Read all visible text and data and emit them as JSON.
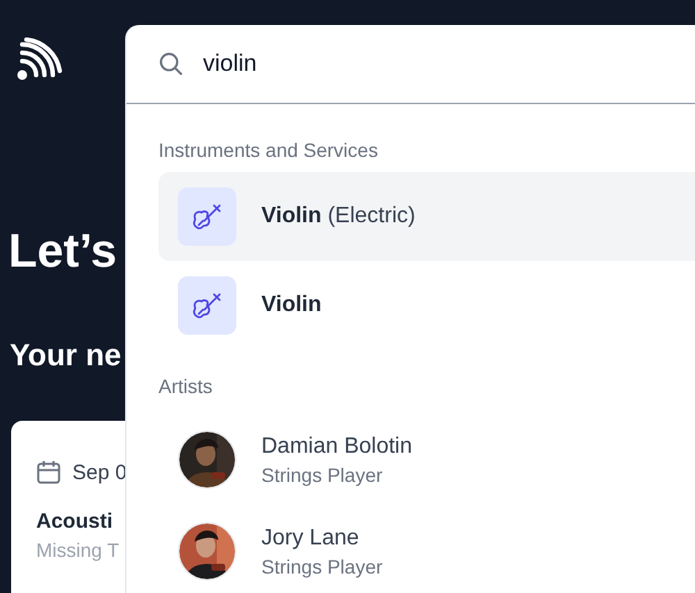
{
  "background": {
    "heading": "Let’s",
    "subheading": "Your ne",
    "event_card": {
      "date": "Sep 0",
      "title": "Acousti",
      "subtitle": "Missing T"
    }
  },
  "search": {
    "value": "violin"
  },
  "instruments": {
    "label": "Instruments and Services",
    "items": [
      {
        "name": "Violin",
        "detail": "(Electric)",
        "selected": true
      },
      {
        "name": "Violin",
        "selected": false
      }
    ]
  },
  "artists": {
    "label": "Artists",
    "items": [
      {
        "name": "Damian Bolotin",
        "role": "Strings Player",
        "kind": "picture"
      },
      {
        "name": "Jory Lane",
        "role": "Strings Player",
        "kind": "picture"
      }
    ]
  }
}
